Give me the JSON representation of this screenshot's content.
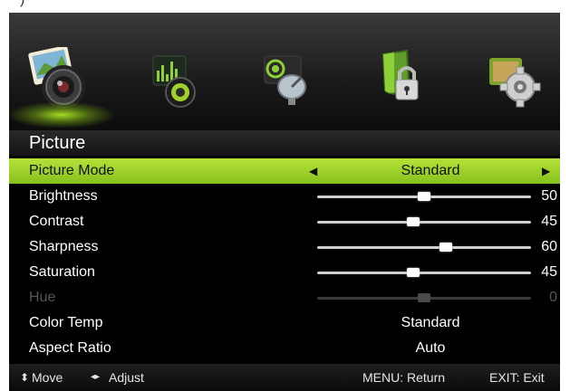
{
  "menu": {
    "tabs": [
      {
        "name": "picture",
        "icon": "camera-photo-icon",
        "selected": true
      },
      {
        "name": "audio",
        "icon": "speaker-equalizer-icon",
        "selected": false
      },
      {
        "name": "channel",
        "icon": "satellite-dish-icon",
        "selected": false
      },
      {
        "name": "lock",
        "icon": "shield-lock-icon",
        "selected": false
      },
      {
        "name": "setup",
        "icon": "gear-icon",
        "selected": false
      }
    ],
    "section_title": "Picture"
  },
  "rows": {
    "picture_mode": {
      "label": "Picture Mode",
      "value": "Standard"
    },
    "brightness": {
      "label": "Brightness",
      "value": "50",
      "level": 50
    },
    "contrast": {
      "label": "Contrast",
      "value": "45",
      "level": 45
    },
    "sharpness": {
      "label": "Sharpness",
      "value": "60",
      "level": 60
    },
    "saturation": {
      "label": "Saturation",
      "value": "45",
      "level": 45
    },
    "hue": {
      "label": "Hue",
      "value": "0",
      "level": 50,
      "disabled": true
    },
    "color_temp": {
      "label": "Color Temp",
      "value": "Standard"
    },
    "aspect_ratio": {
      "label": "Aspect Ratio",
      "value": "Auto"
    }
  },
  "footer": {
    "move": "Move",
    "adjust": "Adjust",
    "menu_return": "MENU: Return",
    "exit": "EXIT: Exit"
  },
  "colors": {
    "highlight": "#9fd12a",
    "background": "#000000"
  }
}
